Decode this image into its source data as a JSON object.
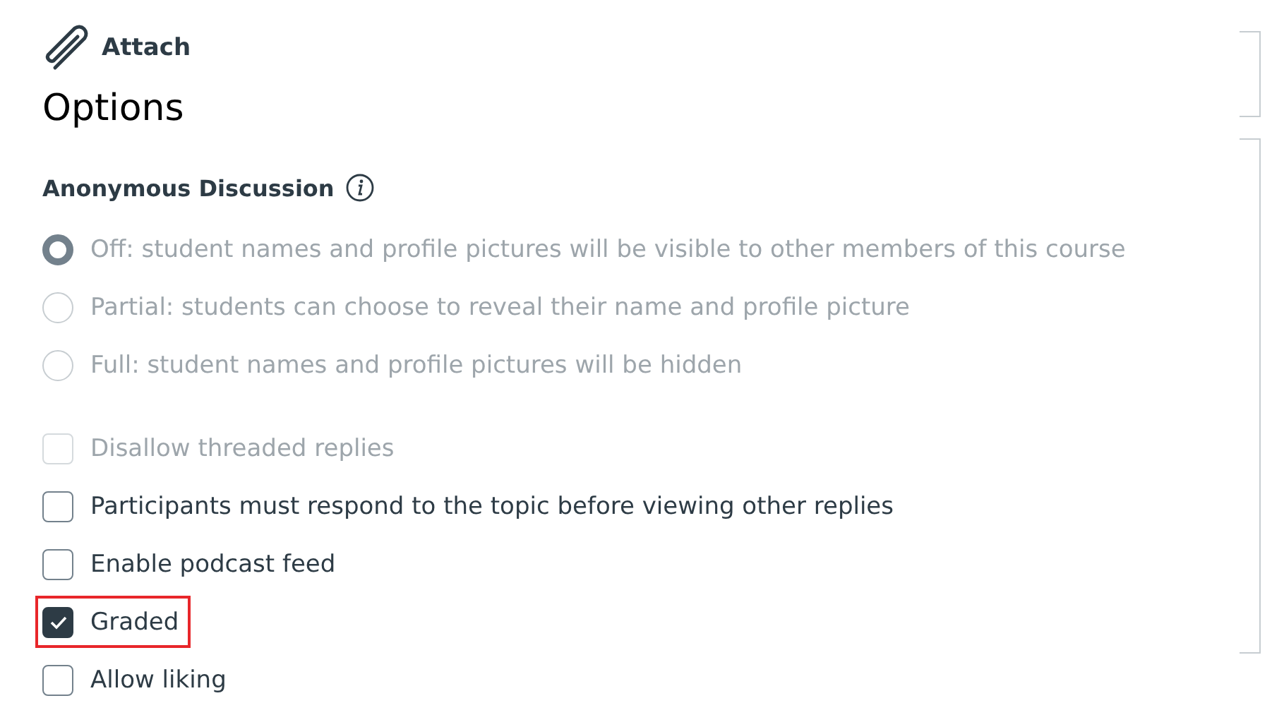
{
  "attach": {
    "label": "Attach"
  },
  "heading": "Options",
  "anonymous": {
    "label": "Anonymous Discussion",
    "options": [
      {
        "kind": "radio",
        "label": "Off: student names and profile pictures will be visible to other members of this course",
        "selected": true,
        "disabled": true
      },
      {
        "kind": "radio",
        "label": "Partial: students can choose to reveal their name and profile picture",
        "selected": false,
        "disabled": true
      },
      {
        "kind": "radio",
        "label": "Full: student names and profile pictures will be hidden",
        "selected": false,
        "disabled": true
      }
    ]
  },
  "settings": [
    {
      "kind": "checkbox",
      "label": "Disallow threaded replies",
      "checked": false,
      "disabled": true,
      "highlighted": false
    },
    {
      "kind": "checkbox",
      "label": "Participants must respond to the topic before viewing other replies",
      "checked": false,
      "disabled": false,
      "highlighted": false
    },
    {
      "kind": "checkbox",
      "label": "Enable podcast feed",
      "checked": false,
      "disabled": false,
      "highlighted": false
    },
    {
      "kind": "checkbox",
      "label": "Graded",
      "checked": true,
      "disabled": false,
      "highlighted": true
    },
    {
      "kind": "checkbox",
      "label": "Allow liking",
      "checked": false,
      "disabled": false,
      "highlighted": false
    }
  ]
}
